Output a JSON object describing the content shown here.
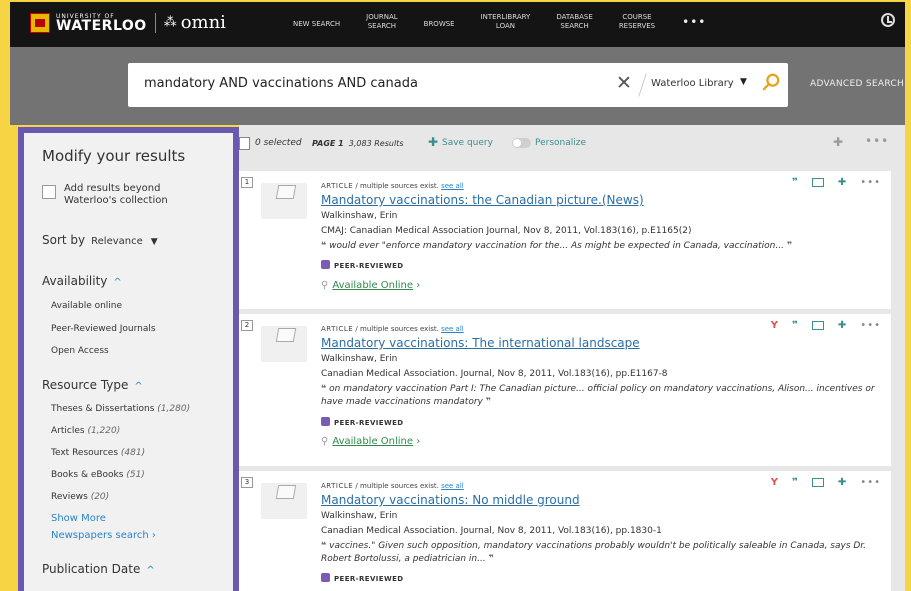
{
  "header": {
    "uw_small": "UNIVERSITY OF",
    "uw_big": "WATERLOO",
    "app_name": "omni",
    "nav": [
      {
        "line1": "NEW SEARCH",
        "line2": ""
      },
      {
        "line1": "JOURNAL",
        "line2": "SEARCH"
      },
      {
        "line1": "BROWSE",
        "line2": ""
      },
      {
        "line1": "INTERLIBRARY",
        "line2": "LOAN"
      },
      {
        "line1": "DATABASE",
        "line2": "SEARCH"
      },
      {
        "line1": "COURSE",
        "line2": "RESERVES"
      }
    ],
    "more": "•••",
    "history_icon": "history-icon"
  },
  "search": {
    "query": "mandatory AND vaccinations AND canada",
    "clear": "✕",
    "scope": "Waterloo Library",
    "scope_caret": "▼",
    "advanced": "ADVANCED SEARCH"
  },
  "sidebar": {
    "title": "Modify your results",
    "add_results_label": "Add results beyond Waterloo's collection",
    "sort_label": "Sort by",
    "sort_value": "Relevance",
    "availability": {
      "heading": "Availability",
      "items": [
        "Available online",
        "Peer-Reviewed Journals",
        "Open Access"
      ]
    },
    "resource_type": {
      "heading": "Resource Type",
      "items": [
        {
          "label": "Theses & Dissertations",
          "count": "(1,280)"
        },
        {
          "label": "Articles",
          "count": "(1,220)"
        },
        {
          "label": "Text Resources",
          "count": "(481)"
        },
        {
          "label": "Books & eBooks",
          "count": "(51)"
        },
        {
          "label": "Reviews",
          "count": "(20)"
        }
      ],
      "show_more": "Show More",
      "newspapers": "Newspapers search"
    },
    "publication_date": {
      "heading": "Publication Date"
    },
    "chevron_up": "^"
  },
  "toolbar": {
    "selected": "0 selected",
    "page_label": "PAGE 1",
    "results": "3,083 Results",
    "save_query": "Save query",
    "personalize": "Personalize"
  },
  "results": [
    {
      "num": "1",
      "type_kind": "ARTICLE",
      "type_rest": " / multiple sources exist.",
      "see_all": "see all",
      "title": "Mandatory vaccinations: the Canadian picture.(News)",
      "author": "Walkinshaw, Erin",
      "source": "CMAJ: Canadian Medical Association Journal, Nov 8, 2011, Vol.183(16), p.E1165(2)",
      "snippet": "would ever \"enforce mandatory vaccination for the... As might be expected in Canada, vaccination...",
      "peer": "PEER-REVIEWED",
      "available": "Available Online",
      "altmetric": false
    },
    {
      "num": "2",
      "type_kind": "ARTICLE",
      "type_rest": " / multiple sources exist.",
      "see_all": "see all",
      "title": "Mandatory vaccinations: The international landscape",
      "author": "Walkinshaw, Erin",
      "source": "Canadian Medical Association. Journal, Nov 8, 2011, Vol.183(16), pp.E1167-8",
      "snippet": "on mandatory vaccination Part I: The Canadian picture... official policy on mandatory vaccinations, Alison... incentives or have made vaccinations mandatory",
      "peer": "PEER-REVIEWED",
      "available": "Available Online",
      "altmetric": true
    },
    {
      "num": "3",
      "type_kind": "ARTICLE",
      "type_rest": " / multiple sources exist.",
      "see_all": "see all",
      "title": "Mandatory vaccinations: No middle ground",
      "author": "Walkinshaw, Erin",
      "source": "Canadian Medical Association. Journal, Nov 8, 2011, Vol.183(16), pp.1830-1",
      "snippet": "vaccines.\" Given such opposition, mandatory vaccinations probably wouldn't be politically saleable in Canada, says Dr. Robert Bortolussi, a pediatrician in...",
      "peer": "PEER-REVIEWED",
      "available": "",
      "altmetric": true
    }
  ],
  "glyphs": {
    "quote_open": "❝",
    "quote_close": "❞",
    "altmetric": "Y",
    "cite": "❞",
    "pin": "✚",
    "more": "•••",
    "link": "⚲",
    "arrow": "›"
  }
}
